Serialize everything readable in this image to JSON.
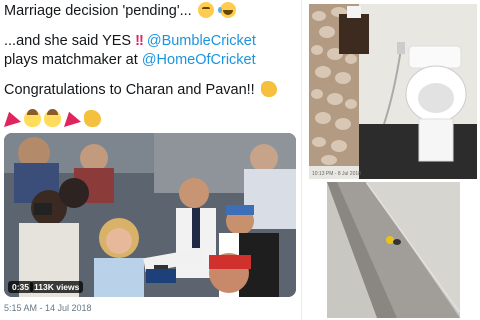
{
  "tweet": {
    "line1": "Marriage decision 'pending'...",
    "line2_prefix": "...and she said YES",
    "line2_bangs": "!!",
    "line2_mention": "@BumbleCricket",
    "line3_prefix": "plays matchmaker at",
    "line3_mention": "@HomeOfCricket",
    "line4": "Congratulations to Charan and Pavan!!",
    "video_duration": "0:35",
    "video_views": "113K views",
    "timestamp": "5:15 AM - 14 Jul 2018"
  },
  "photo_caption": "10:13 PM - 8 Jul 2018",
  "colors": {
    "mention": "#1b95e0",
    "text": "#14171a",
    "meta": "#657786"
  },
  "icons": [
    "thinking-emoji",
    "joy-emoji",
    "clap-emoji",
    "party-popper-emoji",
    "groom-emoji",
    "bride-emoji"
  ]
}
